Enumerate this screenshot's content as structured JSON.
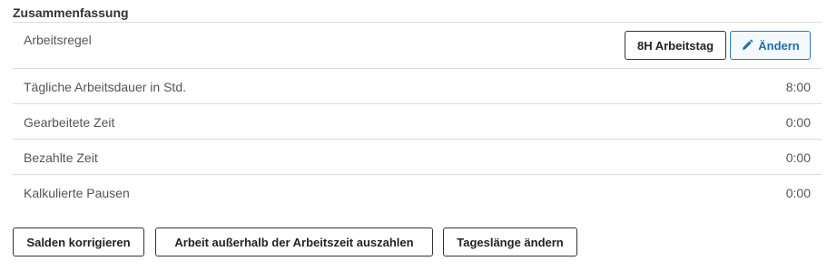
{
  "summary": {
    "title": "Zusammenfassung",
    "work_rule": {
      "label": "Arbeitsregel",
      "current_rule_button": "8H Arbeitstag",
      "edit_button": "Ändern",
      "edit_icon": "pencil-icon"
    },
    "rows": [
      {
        "label": "Tägliche Arbeitsdauer in Std.",
        "value": "8:00"
      },
      {
        "label": "Gearbeitete Zeit",
        "value": "0:00"
      },
      {
        "label": "Bezahlte Zeit",
        "value": "0:00"
      },
      {
        "label": "Kalkulierte Pausen",
        "value": "0:00"
      }
    ]
  },
  "actions": {
    "correct_balances": "Salden korrigieren",
    "pay_out_overtime": "Arbeit außerhalb der Arbeitszeit auszahlen",
    "change_day_length": "Tageslänge ändern"
  },
  "colors": {
    "accent": "#1f6fae",
    "divider": "#dcdcdc",
    "text": "#555555"
  }
}
